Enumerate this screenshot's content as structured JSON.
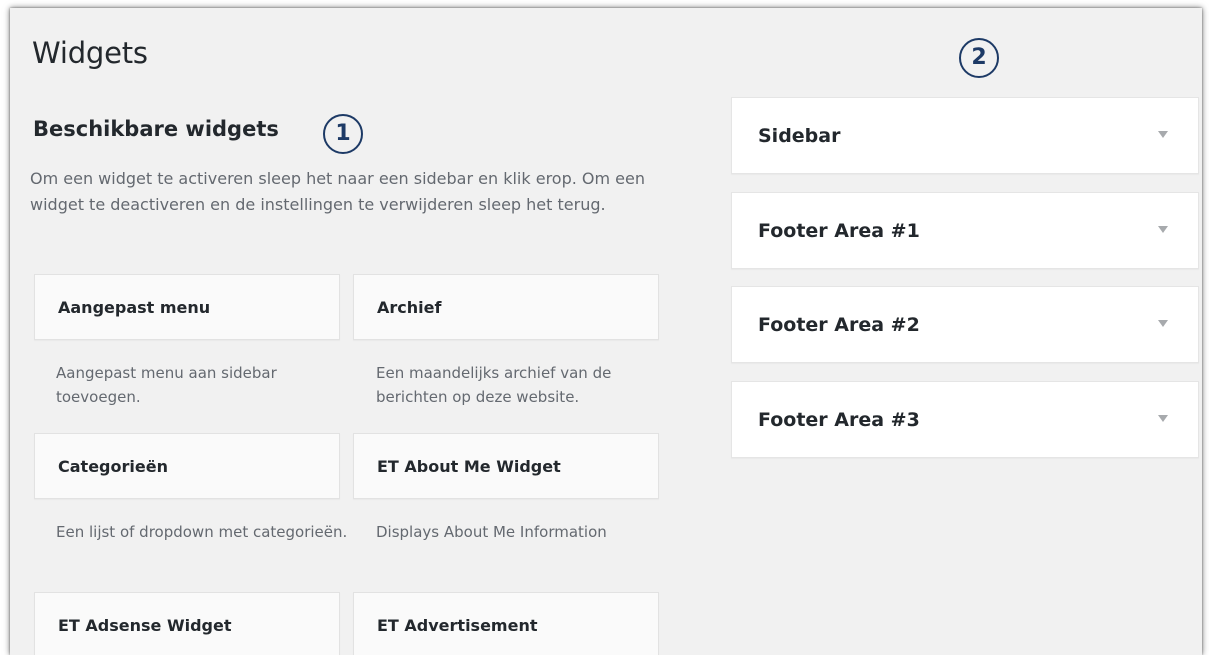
{
  "page": {
    "title": "Widgets"
  },
  "available": {
    "title": "Beschikbare widgets",
    "marker": "1",
    "description": "Om een widget te activeren sleep het naar een sidebar en klik erop. Om een widget te deactiveren en de instellingen te verwijderen sleep het terug.",
    "widgets": [
      {
        "title": "Aangepast menu",
        "description": "Aangepast menu aan sidebar toevoegen."
      },
      {
        "title": "Archief",
        "description": "Een maandelijks archief van de berichten op deze website."
      },
      {
        "title": "Categorieën",
        "description": "Een lijst of dropdown met categorieën."
      },
      {
        "title": "ET About Me Widget",
        "description": "Displays About Me Information"
      },
      {
        "title": "ET Adsense Widget",
        "description": ""
      },
      {
        "title": "ET Advertisement",
        "description": ""
      }
    ]
  },
  "areas": {
    "marker": "2",
    "items": [
      {
        "title": "Sidebar"
      },
      {
        "title": "Footer Area #1"
      },
      {
        "title": "Footer Area #2"
      },
      {
        "title": "Footer Area #3"
      }
    ]
  },
  "colors": {
    "background": "#f1f1f1",
    "widget_bg": "#fafafa",
    "area_bg": "#ffffff",
    "marker": "#1d3a66",
    "text": "#23282d",
    "muted": "#646970"
  }
}
